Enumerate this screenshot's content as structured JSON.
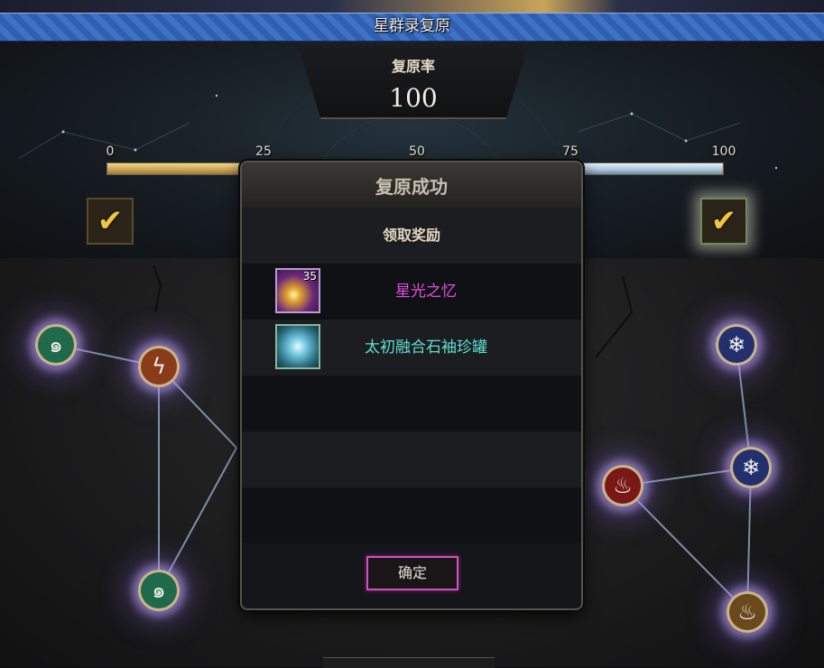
{
  "window": {
    "title": "星群录复原"
  },
  "restore_rate": {
    "label": "复原率",
    "value": "100",
    "progress": 1.0
  },
  "progress_ticks": [
    "0",
    "25",
    "50",
    "75",
    "100"
  ],
  "milestone_rewards": [
    {
      "state": "claimed",
      "icon": "check-icon"
    },
    {
      "state": "claimed",
      "icon": "check-icon"
    }
  ],
  "constellation_nodes": [
    {
      "element": "wind",
      "icon": "swirl-icon",
      "color": "#1f6a4a"
    },
    {
      "element": "lightning",
      "icon": "lightning-icon",
      "color": "#8a3b1a"
    },
    {
      "element": "wind",
      "icon": "swirl-icon",
      "color": "#1f6a4a"
    },
    {
      "element": "ice",
      "icon": "snowflake-icon",
      "color": "#24306e"
    },
    {
      "element": "ice",
      "icon": "snowflake-icon",
      "color": "#24306e"
    },
    {
      "element": "fire",
      "icon": "flame-icon",
      "color": "#7a1818"
    },
    {
      "element": "light",
      "icon": "flame-icon",
      "color": "#6a4a1c"
    }
  ],
  "dialog": {
    "title": "复原成功",
    "subtitle": "领取奖励",
    "items": [
      {
        "name": "星光之忆",
        "count": "35",
        "color": "#e04fe0",
        "icon": "starlight-icon"
      },
      {
        "name": "太初融合石袖珍罐",
        "count": "",
        "color": "#5fe0d0",
        "icon": "crystal-jar-icon"
      }
    ],
    "confirm_label": "确定"
  },
  "colors": {
    "accent_gold": "#c8a152",
    "button_border": "#d24fc0",
    "title_blue": "#3d72c4"
  }
}
